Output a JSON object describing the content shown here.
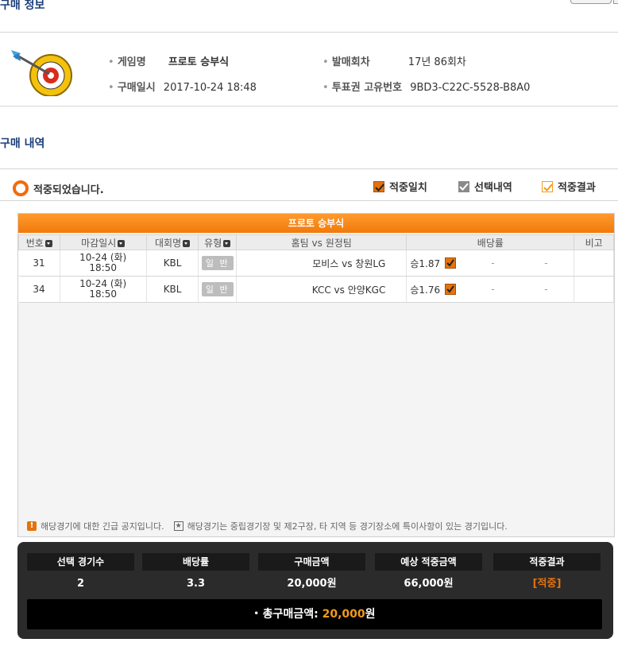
{
  "header": {
    "title": "구매 정보",
    "top_button": ""
  },
  "info": {
    "game_label": "게임명",
    "game_value": "프로토 승부식",
    "round_label": "발매회차",
    "round_value": "17년 86회차",
    "date_label": "구매일시",
    "date_value": "2017-10-24 18:48",
    "ticket_label": "투표권 고유번호",
    "ticket_value": "9BD3-C22C-5528-B8A0"
  },
  "history": {
    "title": "구매 내역"
  },
  "status": {
    "message": "적중되었습니다.",
    "legend": [
      {
        "label": "적중일치",
        "color": "#e2730d"
      },
      {
        "label": "선택내역",
        "color": "#8a8a8a"
      },
      {
        "label": "적중결과",
        "color": "#f39a1c"
      }
    ]
  },
  "panel": {
    "title": "프로토 승부식",
    "columns": [
      "번호",
      "마감일시",
      "대회명",
      "유형",
      "홈팀 vs 원정팀",
      "배당률",
      "비고"
    ],
    "rows": [
      {
        "no": "31",
        "date": "10-24 (화)",
        "time": "18:50",
        "league": "KBL",
        "type": "일 반",
        "match": "모비스 vs 창원LG",
        "odds": "승1.87",
        "draw": "-",
        "lose": "-",
        "note": ""
      },
      {
        "no": "34",
        "date": "10-24 (화)",
        "time": "18:50",
        "league": "KBL",
        "type": "일 반",
        "match": "KCC vs 안양KGC",
        "odds": "승1.76",
        "draw": "-",
        "lose": "-",
        "note": ""
      }
    ],
    "notice1": "해당경기에 대한 긴급 공지입니다.",
    "notice2": "해당경기는 중립경기장 및 제2구장, 타 지역 등 경기장소에 특이사항이 있는 경기입니다."
  },
  "summary": {
    "cells": [
      {
        "label": "선택 경기수",
        "value": "2"
      },
      {
        "label": "배당률",
        "value": "3.3"
      },
      {
        "label": "구매금액",
        "value": "20,000원"
      },
      {
        "label": "예상 적중금액",
        "value": "66,000원"
      },
      {
        "label": "적중결과",
        "value": "[적중]",
        "color": "#e2730d"
      }
    ],
    "total_label": "총구매금액:",
    "total_amount": "20,000",
    "total_unit": "원"
  },
  "colors": {
    "accent": "#f27a0a",
    "title": "#1c3f7a"
  }
}
